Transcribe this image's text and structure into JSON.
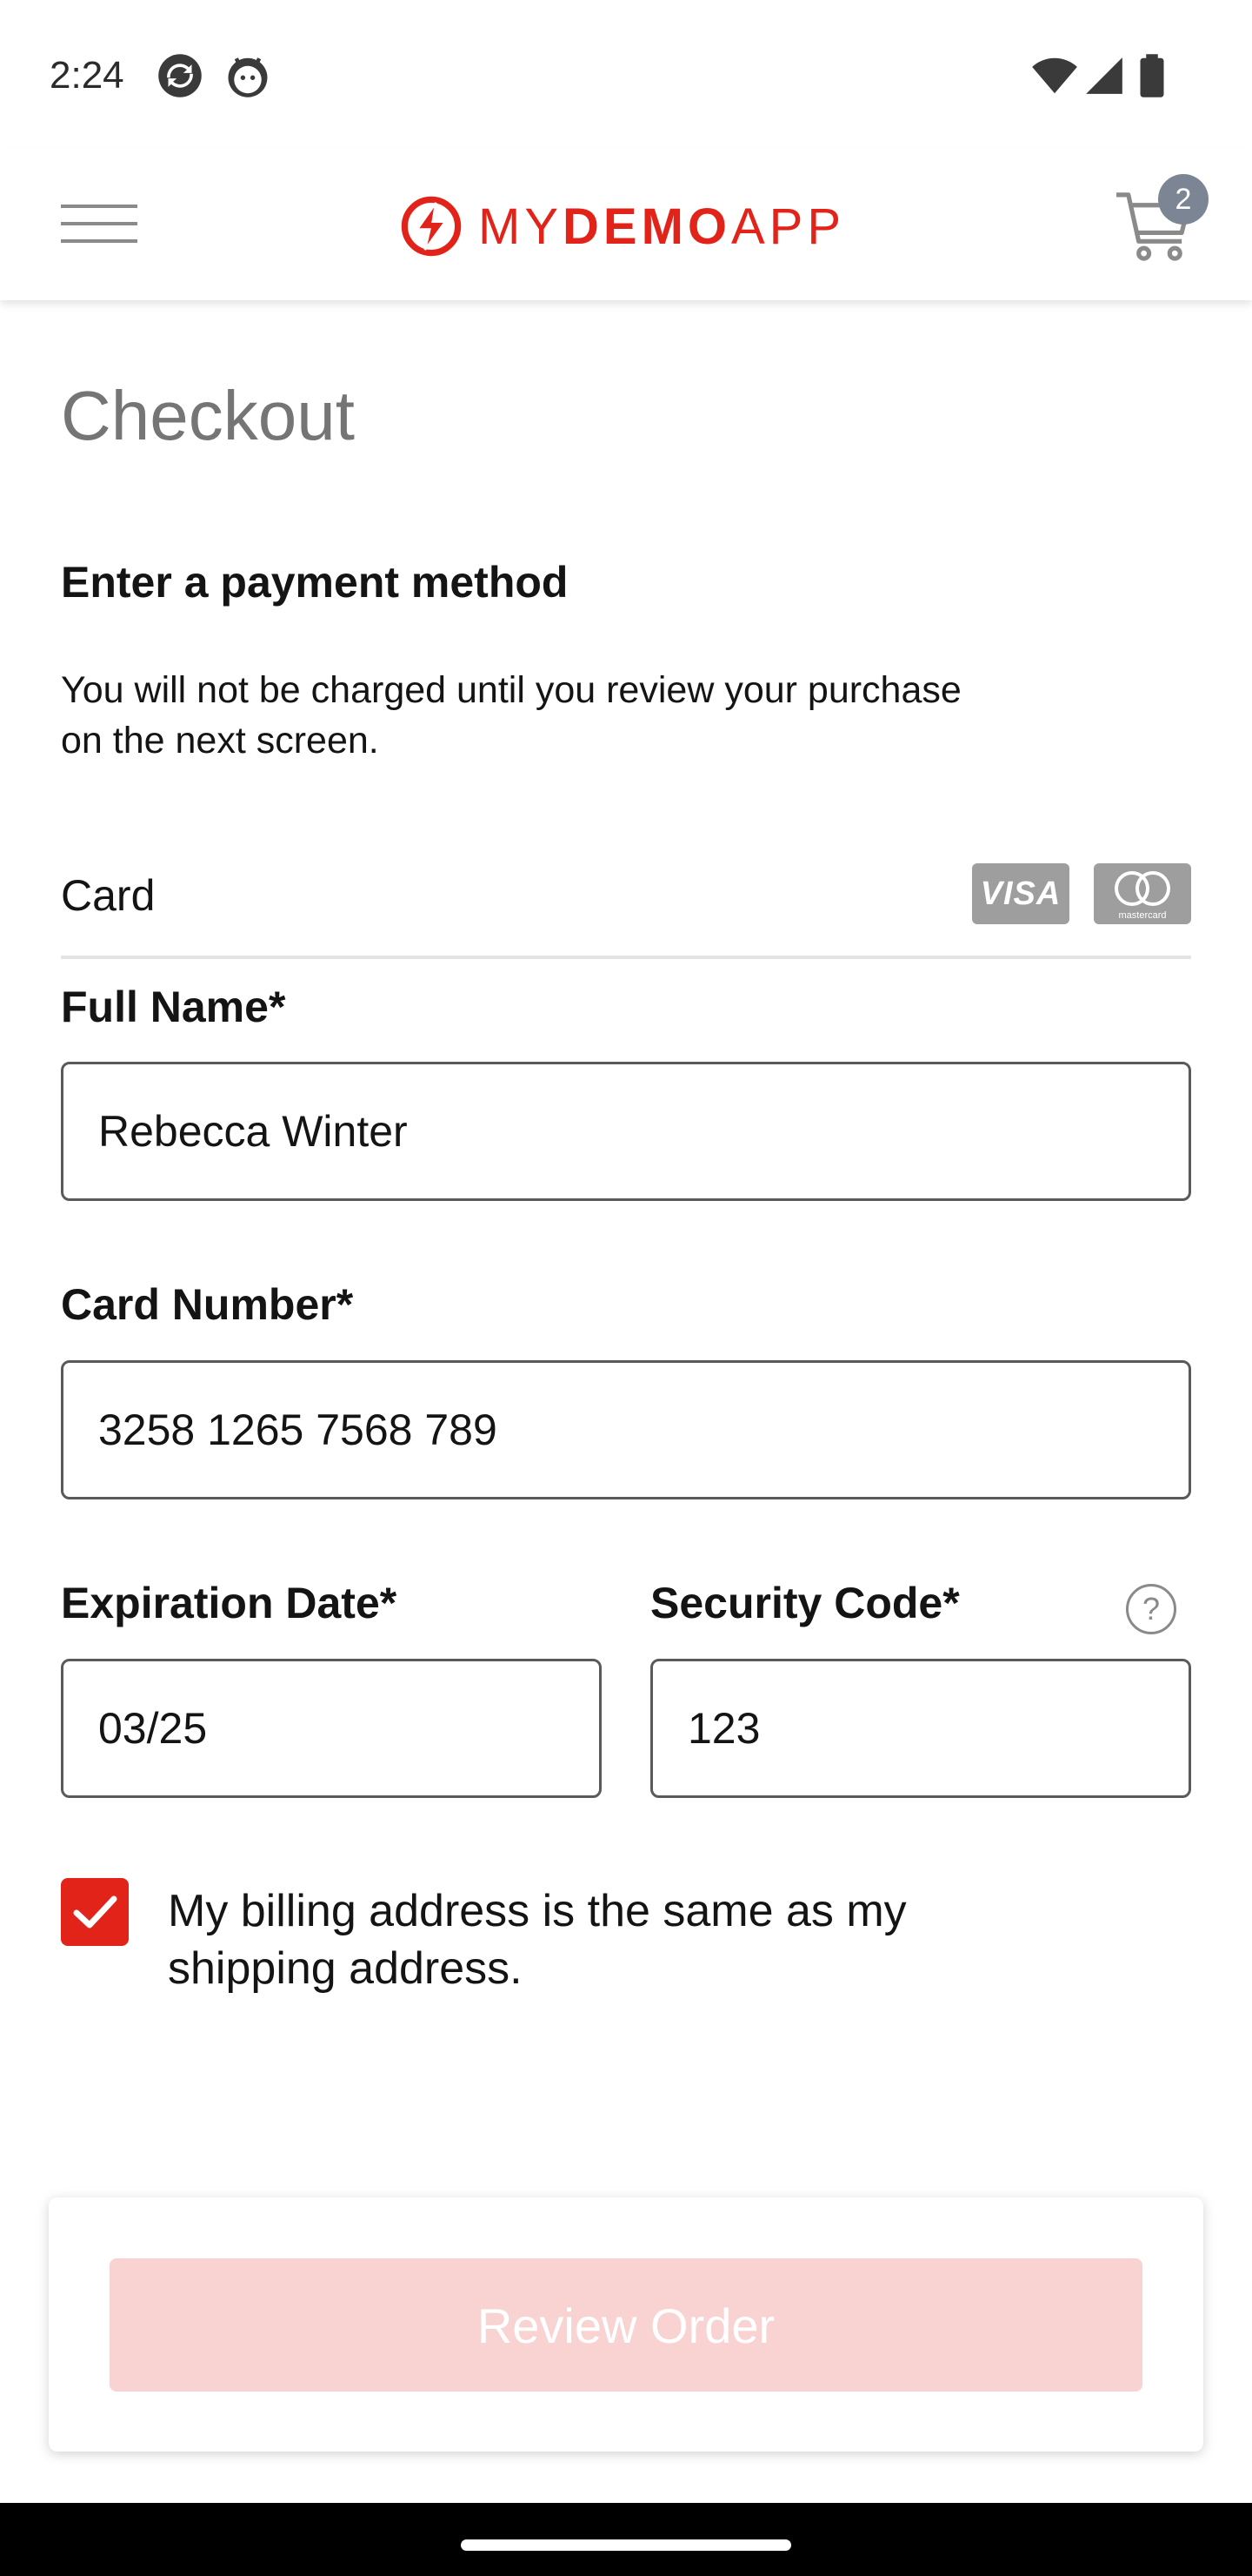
{
  "status_bar": {
    "time": "2:24",
    "icons": [
      "sync-icon",
      "android-icon",
      "wifi-icon",
      "signal-icon",
      "battery-icon"
    ]
  },
  "header": {
    "menu_icon": "hamburger-menu-icon",
    "logo": {
      "prefix": "MY",
      "bold": "DEMO",
      "suffix": "APP",
      "color": "#e2231a"
    },
    "cart_count": "2",
    "cart_icon": "cart-icon"
  },
  "checkout": {
    "title": "Checkout",
    "section_title": "Enter a payment method",
    "description": "You will not be charged until you review your purchase on the next screen.",
    "card_label": "Card",
    "card_brands": {
      "visa": "VISA",
      "mastercard": "mastercard"
    },
    "full_name": {
      "label": "Full Name*",
      "value": "Rebecca Winter"
    },
    "card_number": {
      "label": "Card Number*",
      "value": "3258 1265 7568 789"
    },
    "expiration_date": {
      "label": "Expiration Date*",
      "value": "03/25"
    },
    "security_code": {
      "label": "Security Code*",
      "value": "123",
      "help": "?"
    },
    "billing_same": {
      "checked": true,
      "label": "My billing address is the same as my shipping address."
    },
    "review_button": "Review Order"
  },
  "colors": {
    "accent": "#e2231a",
    "button_disabled_bg": "#f8d3d2",
    "title_gray": "#757575"
  }
}
